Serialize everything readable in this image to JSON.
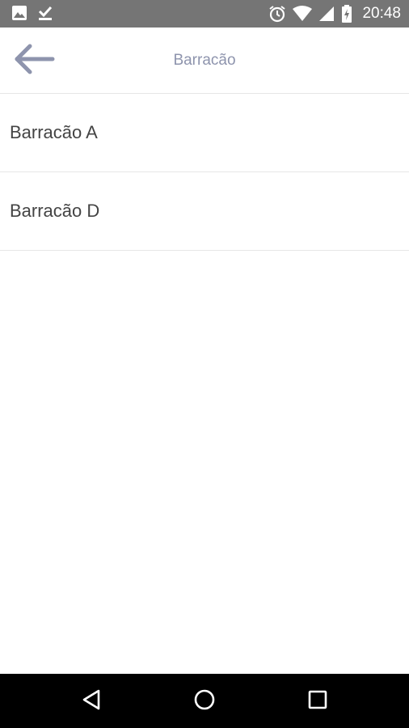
{
  "status_bar": {
    "time": "20:48",
    "left_icons": [
      "image-icon",
      "download-done-icon"
    ],
    "right_icons": [
      "alarm-icon",
      "wifi-icon",
      "signal-icon",
      "battery-charging-icon"
    ]
  },
  "app_bar": {
    "title": "Barracão",
    "back_icon": "arrow-left-icon",
    "accent_color": "#8e94ad"
  },
  "list": {
    "items": [
      {
        "label": "Barracão A"
      },
      {
        "label": "Barracão D"
      }
    ]
  },
  "nav_bar": {
    "buttons": [
      "back-triangle-icon",
      "home-circle-icon",
      "recents-square-icon"
    ]
  }
}
